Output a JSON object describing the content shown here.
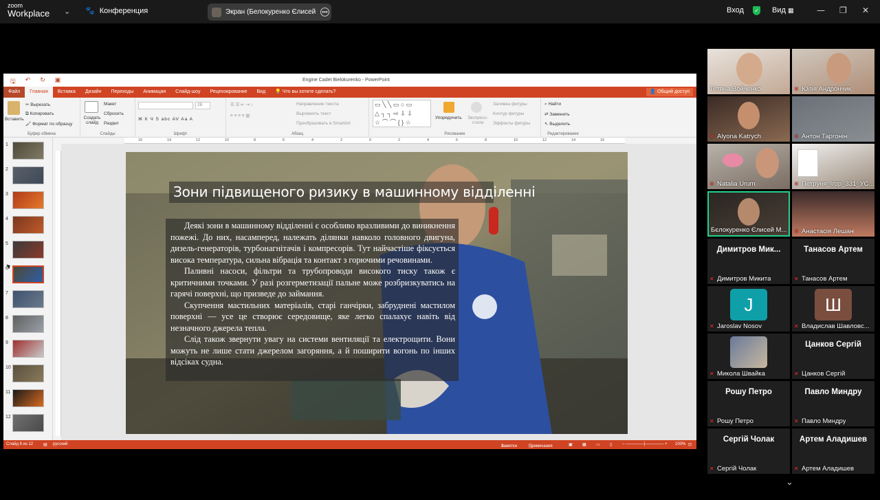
{
  "zoom": {
    "logo_line1": "zoom",
    "logo_line2": "Workplace",
    "conference_label": "Конференция",
    "share_label": "Экран (Белокуренко Єлисей Ми",
    "signin_label": "Вход",
    "view_label": "Вид"
  },
  "ppt": {
    "window_title": "Engine Cadet Bielokurenko - PowerPoint",
    "tabs": [
      "Файл",
      "Главная",
      "Вставка",
      "Дизайн",
      "Переходы",
      "Анимация",
      "Слайд-шоу",
      "Рецензирование",
      "Вид"
    ],
    "tell_me": "Что вы хотите сделать?",
    "share_button": "Общий доступ",
    "ribbon": {
      "paste": "Вставить",
      "cut": "Вырезать",
      "copy": "Копировать",
      "format_painter": "Формат по образцу",
      "clipboard": "Буфер обмена",
      "new_slide": "Создать слайд",
      "layout": "Макет",
      "reset": "Сбросить",
      "section": "Раздел",
      "slides": "Слайды",
      "font": "Шрифт",
      "font_size": "28",
      "font_format": "Ж  К  Ч  S  abc  AV  Aa  A",
      "text_direction": "Направление текста",
      "align_text": "Выровнять текст",
      "smartart": "Преобразовать в SmartArt",
      "paragraph": "Абзац",
      "arrange": "Упорядочить",
      "quick_styles": "Экспресс-стили",
      "shape_fill": "Заливка фигуры",
      "shape_outline": "Контур фигуры",
      "shape_effects": "Эффекты фигуры",
      "drawing": "Рисование",
      "find": "Найти",
      "replace": "Заменить",
      "select": "Выделить",
      "editing": "Редактирование"
    },
    "ruler_numbers": [
      "16",
      "14",
      "12",
      "10",
      "8",
      "6",
      "4",
      "2",
      "0",
      "2",
      "4",
      "6",
      "8",
      "10",
      "12",
      "14",
      "16"
    ],
    "thumb_numbers": [
      "1",
      "2",
      "3",
      "4",
      "5",
      "6",
      "7",
      "8",
      "9",
      "10",
      "11",
      "12"
    ],
    "slide": {
      "title": "Зони підвищеного ризику в машинному відділенні",
      "p1": "Деякі зони в машинному відділенні є особливо вразливими до виникнення пожежі. До них, насамперед, належать ділянки навколо головного двигуна, дизель-генераторів, турбонагнітачів і компресорів. Тут найчастіше фіксується висока температура, сильна вібрація та контакт з горючими речовинами.",
      "p2": "Паливні насоси, фільтри та трубопроводи високого тиску також є критичними точками. У разі розгерметизації пальне може розбризкуватись на гарячі поверхні, що призведе до займання.",
      "p3": "Скупчення мастильних матеріалів, старі ганчірки, забруднені мастилом поверхні — усе це створює середовище, яке легко спалахує навіть від незначного джерела тепла.",
      "p4": "Слід також звернути увагу на системи вентиляції та електрощити. Вони можуть не лише стати джерелом загоряння, а й поширити вогонь по інших відсіках судна."
    },
    "status": {
      "slide_of": "Слайд 6 из 12",
      "language": "русский",
      "notes": "Заметки",
      "comments": "Примечания",
      "zoom": "100%"
    }
  },
  "participants": [
    {
      "name": "Тетяна Войченко",
      "type": "video",
      "muted": false
    },
    {
      "name": "Юлія Андрончик",
      "type": "video",
      "muted": true
    },
    {
      "name": "Alyona Katrych",
      "type": "video",
      "muted": true
    },
    {
      "name": "Антон Таргонін",
      "type": "video",
      "muted": true
    },
    {
      "name": "Natalia Urum",
      "type": "video",
      "muted": true
    },
    {
      "name": "Петруня_Ігор_331_УС...",
      "type": "video",
      "muted": true
    },
    {
      "name": "Бєлокуренко Єлисей М...",
      "type": "video",
      "muted": false
    },
    {
      "name": "Анастасія Лешан",
      "type": "video",
      "muted": true
    },
    {
      "name": "Димитров Микита",
      "big": "Димитров  Мик...",
      "type": "name",
      "muted": true
    },
    {
      "name": "Танасов Артем",
      "big": "Танасов Артем",
      "type": "name",
      "muted": true
    },
    {
      "name": "Jaroslav Nosov",
      "letter": "J",
      "color": "#0f9fa8",
      "type": "letter",
      "muted": true
    },
    {
      "name": "Владислав Шавловс...",
      "letter": "Ш",
      "color": "#7a4e3e",
      "type": "letter",
      "muted": true
    },
    {
      "name": "Микола Швайка",
      "type": "image",
      "muted": true
    },
    {
      "name": "Цанков Сергій",
      "big": "Цанков Сергій",
      "type": "name",
      "muted": true
    },
    {
      "name": "Рошу Петро",
      "big": "Рошу Петро",
      "type": "name",
      "muted": true
    },
    {
      "name": "Павло Миндру",
      "big": "Павло Миндру",
      "type": "name",
      "muted": true
    },
    {
      "name": "Сергій Чолак",
      "big": "Сергій Чолак",
      "type": "name",
      "muted": true
    },
    {
      "name": "Артем Аладишев",
      "big": "Артем Аладишев",
      "type": "name",
      "muted": true
    }
  ],
  "colors": {
    "ppt_accent": "#d04423",
    "zoom_active": "#23d18b",
    "muted_mic": "#ff3b30"
  }
}
